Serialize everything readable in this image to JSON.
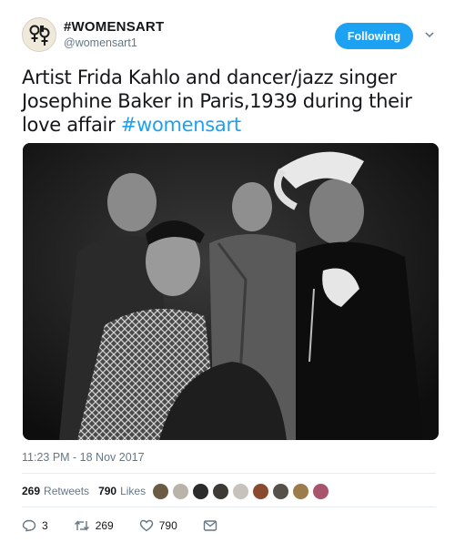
{
  "account": {
    "display_name": "#WOMENSART",
    "handle": "@womensart1",
    "follow_label": "Following"
  },
  "tweet": {
    "text_plain": "Artist Frida Kahlo and dancer/jazz singer Josephine Baker in Paris,1939 during their love affair ",
    "hashtag": "#womensart",
    "timestamp": "11:23 PM - 18 Nov 2017"
  },
  "stats": {
    "retweets": "269",
    "retweets_label": "Retweets",
    "likes": "790",
    "likes_label": "Likes"
  },
  "actions": {
    "reply_count": "3",
    "retweet_count": "269",
    "like_count": "790"
  },
  "icons": [
    "reply-icon",
    "retweet-icon",
    "heart-icon",
    "message-icon",
    "chevron-down-icon"
  ],
  "colors": {
    "accent": "#1da1f2",
    "text": "#14171a",
    "muted": "#657786",
    "border": "#e6ecf0"
  }
}
